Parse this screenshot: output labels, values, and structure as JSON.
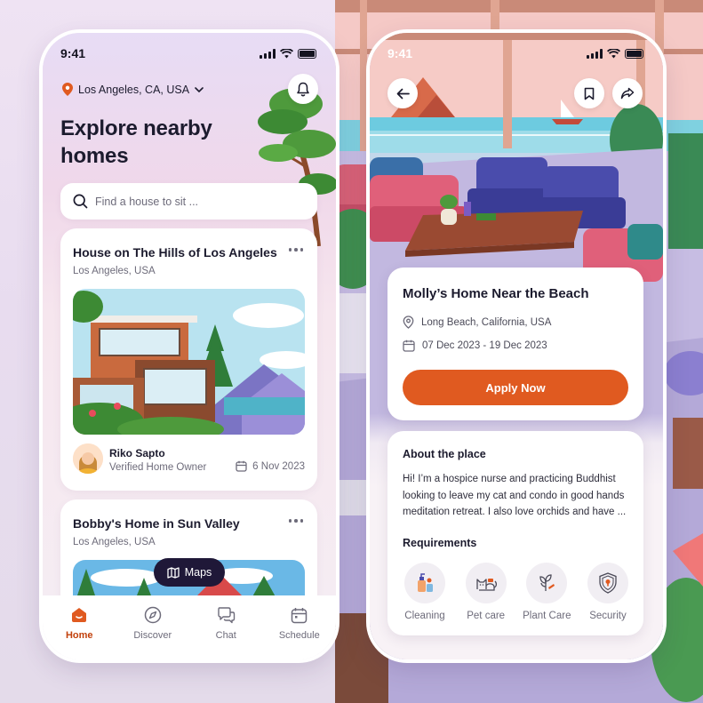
{
  "status": {
    "time": "9:41"
  },
  "home": {
    "location": "Los Angeles, CA, USA",
    "title": "Explore nearby homes",
    "search_placeholder": "Find a house to sit ...",
    "listings": [
      {
        "title": "House on The Hills of Los Angeles",
        "location": "Los Angeles, USA",
        "owner_name": "Riko Sapto",
        "owner_role": "Verified Home Owner",
        "date": "6 Nov 2023"
      },
      {
        "title": "Bobby's Home in Sun Valley",
        "location": "Los Angeles, USA"
      }
    ],
    "maps_label": "Maps",
    "tabs": [
      {
        "label": "Home",
        "icon": "home-icon",
        "active": true
      },
      {
        "label": "Discover",
        "icon": "compass-icon",
        "active": false
      },
      {
        "label": "Chat",
        "icon": "chat-icon",
        "active": false
      },
      {
        "label": "Schedule",
        "icon": "calendar-icon",
        "active": false
      }
    ]
  },
  "detail": {
    "title": "Molly’s Home Near the Beach",
    "location": "Long Beach, California, USA",
    "dates": "07 Dec 2023 - 19 Dec 2023",
    "apply_label": "Apply Now",
    "about_title": "About the place",
    "about_text": "Hi! I’m a hospice nurse and practicing Buddhist looking to leave my cat and condo in good hands meditation retreat. I also love orchids and have ...",
    "requirements_title": "Requirements",
    "requirements": [
      {
        "label": "Cleaning",
        "icon": "cleaning-icon"
      },
      {
        "label": "Pet care",
        "icon": "cat-icon"
      },
      {
        "label": "Plant Care",
        "icon": "plant-icon"
      },
      {
        "label": "Security",
        "icon": "shield-icon"
      }
    ]
  },
  "colors": {
    "accent": "#e05a20",
    "active_tab": "#c2410c",
    "maps_button": "#1f1838",
    "text_primary": "#1c1b2e",
    "text_secondary": "#6d6b7a"
  }
}
